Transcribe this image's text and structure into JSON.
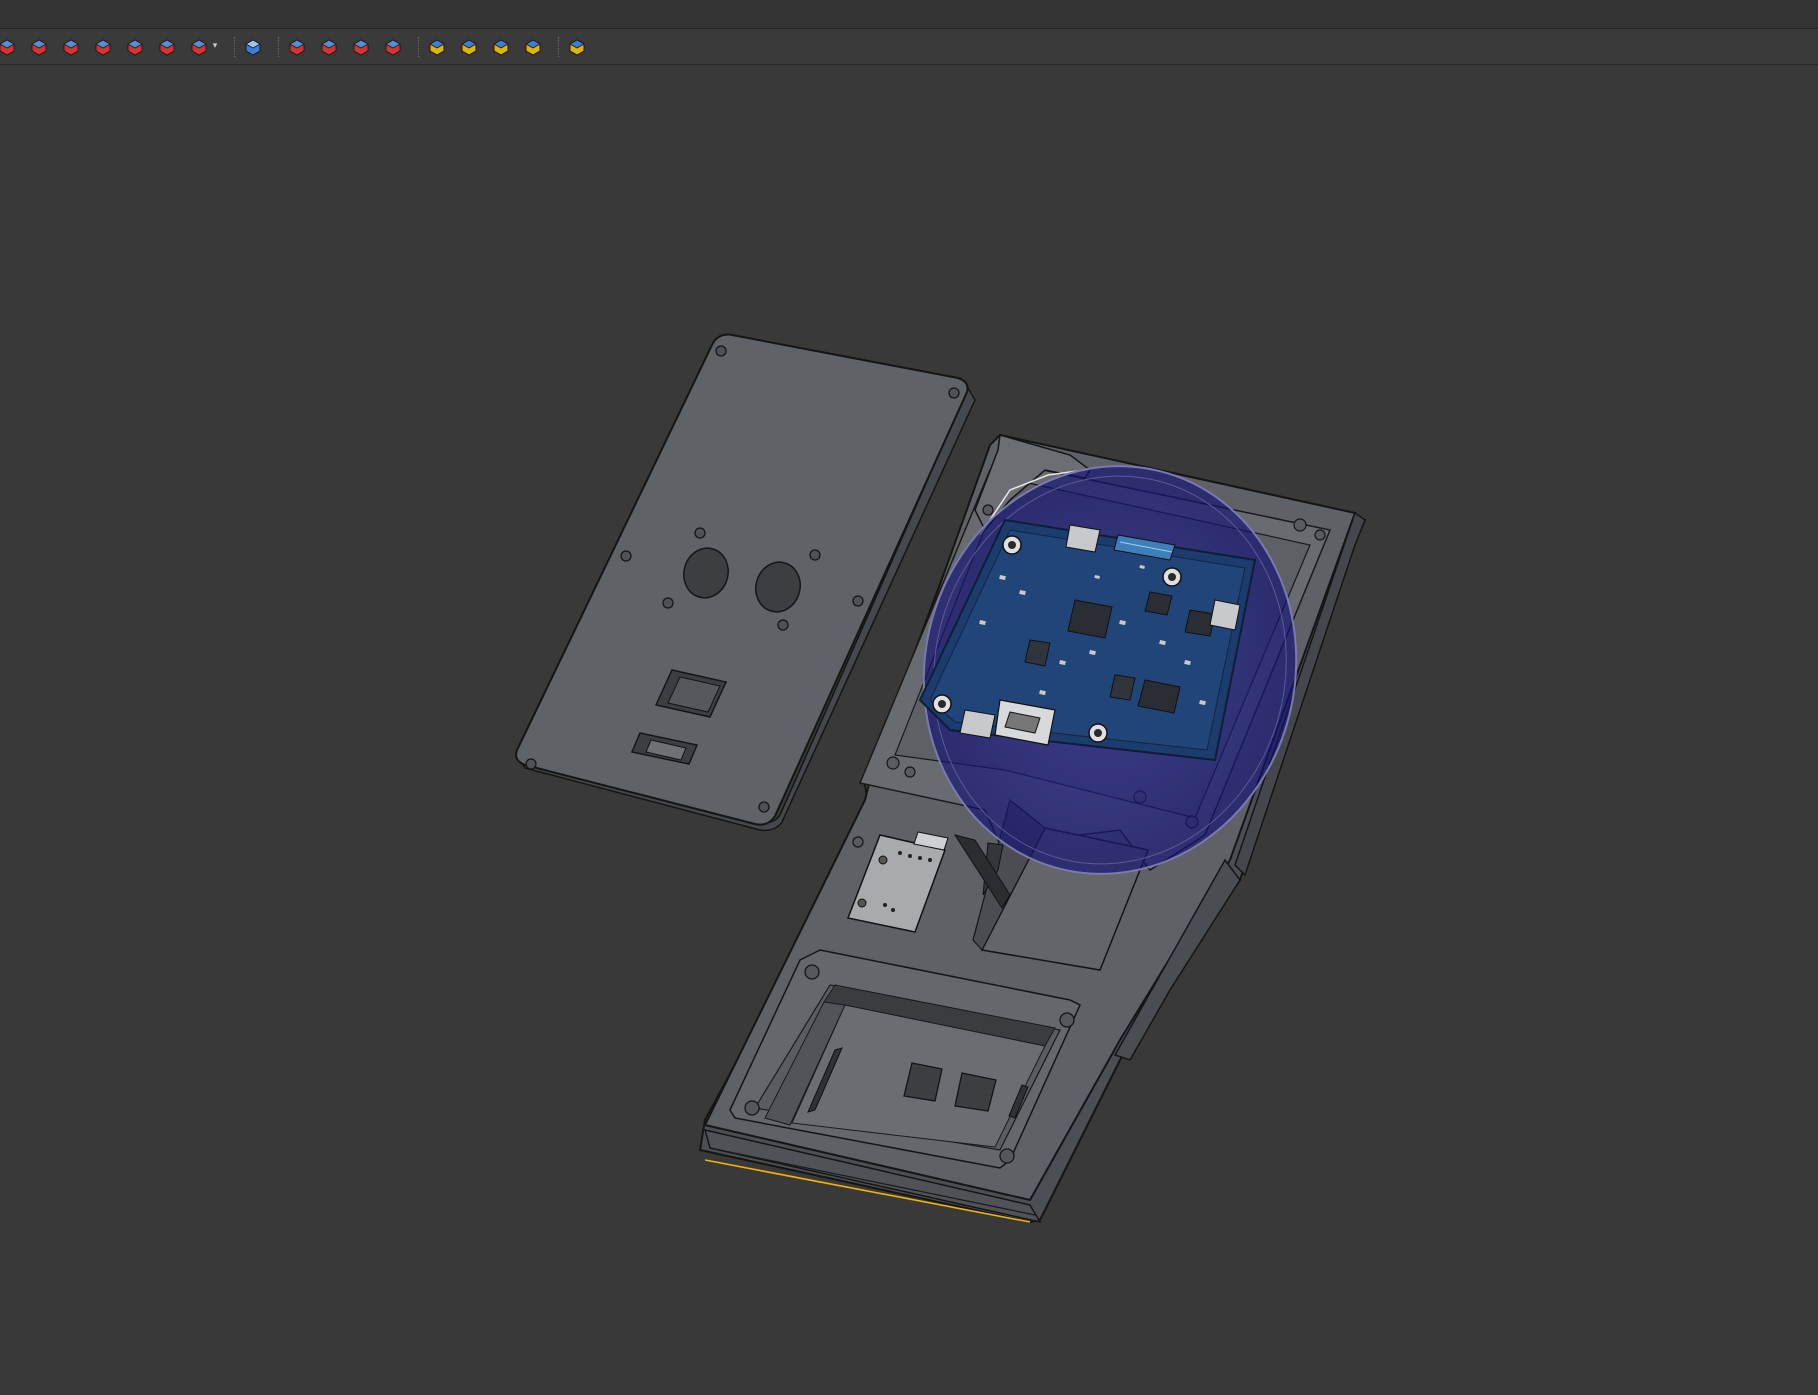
{
  "app": {
    "title_bar_text": ""
  },
  "toolbar": {
    "groups": [
      {
        "name": "part-design-features",
        "buttons": [
          {
            "icon": "chamfer-icon",
            "color": "#d9342b"
          },
          {
            "icon": "pocket-icon",
            "color": "#d9342b"
          },
          {
            "icon": "groove-icon",
            "color": "#d9342b"
          },
          {
            "icon": "subtractive-box-icon",
            "color": "#d9342b"
          },
          {
            "icon": "subtractive-pipe-icon",
            "color": "#d9342b"
          },
          {
            "icon": "subtractive-helix-icon",
            "color": "#d9342b"
          },
          {
            "icon": "subtractive-primitive-icon",
            "color": "#d9342b",
            "has_dropdown": true
          }
        ]
      },
      {
        "name": "boolean",
        "buttons": [
          {
            "icon": "boolean-icon",
            "color": "#3b7dd8"
          }
        ]
      },
      {
        "name": "dress-up",
        "buttons": [
          {
            "icon": "fillet-icon",
            "color": "#d9342b"
          },
          {
            "icon": "chamfer-icon",
            "color": "#d9342b"
          },
          {
            "icon": "draft-icon",
            "color": "#d9342b"
          },
          {
            "icon": "thickness-icon",
            "color": "#d9342b"
          }
        ]
      },
      {
        "name": "transformations",
        "buttons": [
          {
            "icon": "mirrored-icon",
            "color": "#e0b400"
          },
          {
            "icon": "linear-pattern-icon",
            "color": "#e0b400"
          },
          {
            "icon": "polar-pattern-icon",
            "color": "#e0b400"
          },
          {
            "icon": "multi-transform-icon",
            "color": "#e0b400"
          }
        ]
      },
      {
        "name": "sprocket",
        "buttons": [
          {
            "icon": "sprocket-icon",
            "color": "#e0b400"
          }
        ]
      }
    ]
  },
  "scene": {
    "background": "#393939",
    "objects": [
      {
        "name": "enclosure-lid",
        "color": "#5f6368",
        "holes": 2,
        "slots": 2
      },
      {
        "name": "enclosure-base",
        "color": "#5a5d62"
      },
      {
        "name": "pcb-board",
        "color": "#1f3f73"
      },
      {
        "name": "transparent-disc",
        "color": "#1a1a8a"
      },
      {
        "name": "sd-card-module",
        "color": "#a9aaae"
      }
    ],
    "highlight_edge_color": "#f0b400"
  }
}
